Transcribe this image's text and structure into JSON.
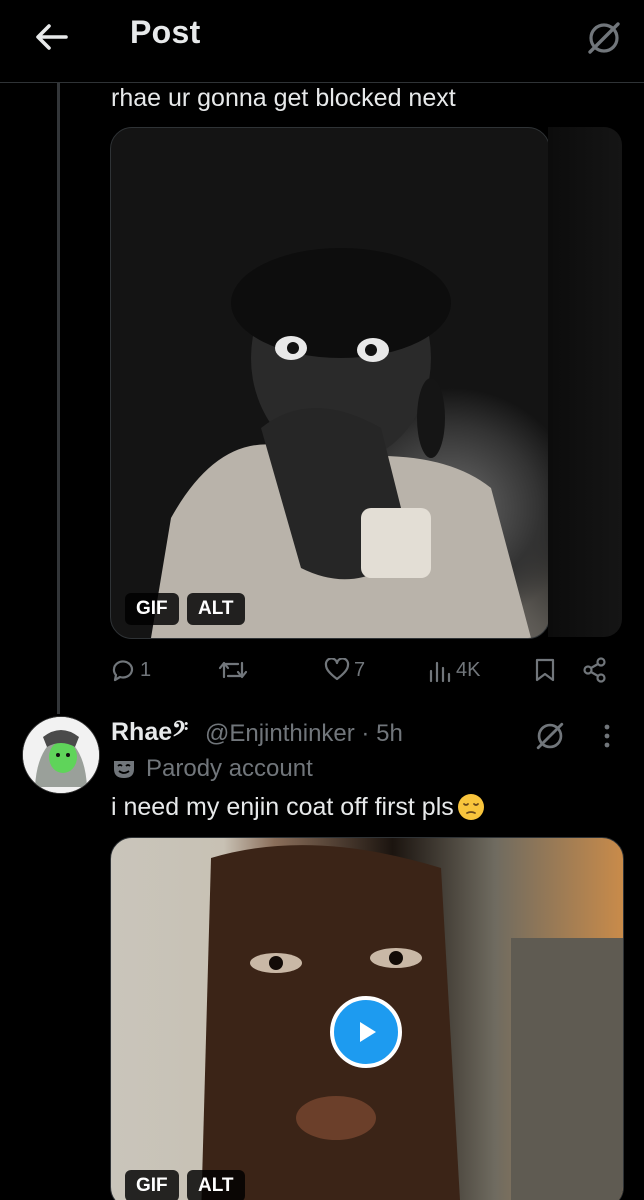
{
  "header": {
    "title": "Post",
    "back_icon": "arrow-left-icon",
    "grok_icon": "grok-icon"
  },
  "post1": {
    "text": "rhae ur gonna get blocked next",
    "media": {
      "type": "gif",
      "gif_label": "GIF",
      "alt_label": "ALT"
    },
    "actions": {
      "replies": "1",
      "retweets": "",
      "likes": "7",
      "views": "4K"
    }
  },
  "post2": {
    "name": "Rhae𝄢",
    "handle_time": "@Enjinthinker · 5h",
    "parody_label": "Parody account",
    "text": "i need my enjin coat off first pls",
    "media": {
      "type": "gif",
      "gif_label": "GIF",
      "alt_label": "ALT"
    }
  },
  "colors": {
    "background": "#000000",
    "text": "#e7e9ea",
    "muted": "#71767b",
    "accent": "#1d9bf0",
    "border": "#2f3336"
  }
}
